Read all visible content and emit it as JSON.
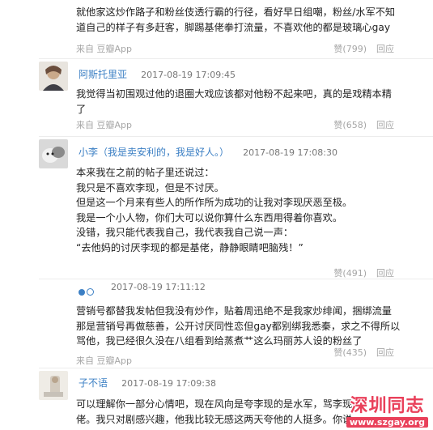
{
  "posts": [
    {
      "lines": [
        "就他家这炒作路子和粉丝伎透行霸的行径，看好早日组嘲，粉丝/水军不知",
        "道自己的样子有多赶客，脚踢基佬拳打流量，不喜欢他的都是玻璃心gay"
      ],
      "source": "来自 豆瓣App",
      "like_label": "赞(799)",
      "reply_label": "回应"
    },
    {
      "username": "阿斯托里亚",
      "timestamp": "2017-08-19 17:09:45",
      "lines": [
        "我觉得当初围观过他的退圈大戏应该都对他粉不起来吧，真的是戏精本精",
        "了"
      ],
      "source": "来自 豆瓣App",
      "like_label": "赞(658)",
      "reply_label": "回应"
    },
    {
      "username": "小李（我是卖安利的，我是好人。）",
      "timestamp": "2017-08-19 17:08:30",
      "lines": [
        "本来我在之前的帖子里还说过：",
        "我只是不喜欢李现，但是不讨厌。",
        "但是这一个月来有些人的所作所为成功的让我对李现厌恶至极。",
        "我是一个小人物，你们大可以说你算什么东西用得着你喜欢。",
        "没错，我只能代表我自己，我代表我自己说一声：",
        "“去他妈的讨厌李现的都是基佬，静静眼睛吧脑残！”"
      ],
      "like_label": "赞(491)",
      "reply_label": "回应"
    },
    {
      "timestamp": "2017-08-19 17:11:12",
      "lines": [
        "营销号都替我发帖但我没有炒作，贴着周迅绝不是我家炒绯闻，捆绑流量",
        "那是营销号再做慈善，公开讨厌同性恋但gay都别绑我悉秦，求之不得所以",
        "骂他，我已经很久没在八组看到给蒸煮艹这么玛丽苏人设的粉丝了"
      ],
      "source": "来自 豆瓣App",
      "like_label": "赞(435)",
      "reply_label": "回应"
    },
    {
      "username": "子不语",
      "timestamp": "2017-08-19 17:09:38",
      "lines": [
        "可以理解你一部分心情吧，现在风向是夸李现的是水军，骂李现",
        "佬。我只对剧感兴趣，他我比较无感这两天夸他的人挺多。你说"
      ]
    }
  ],
  "watermark": {
    "title": "深圳同志",
    "url": "www.szgay.org"
  },
  "colors": {
    "username": "#3b7fc4",
    "meta": "#a6a6a6",
    "watermark": "#e9405a"
  }
}
